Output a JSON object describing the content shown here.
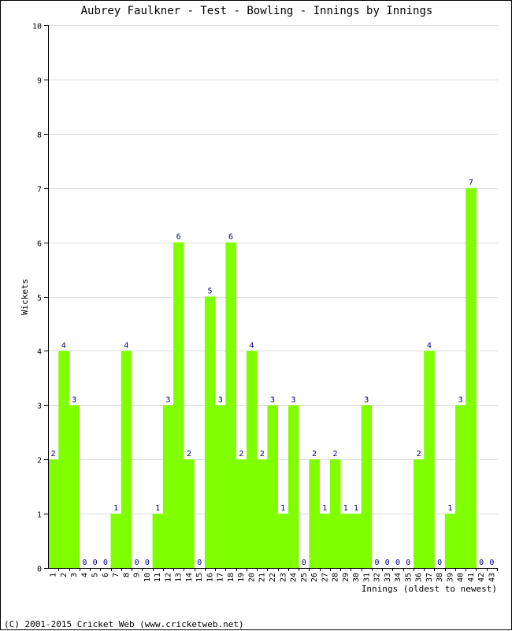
{
  "chart_data": {
    "type": "bar",
    "title": "Aubrey Faulkner - Test - Bowling - Innings by Innings",
    "xlabel": "Innings (oldest to newest)",
    "ylabel": "Wickets",
    "ylim": [
      0,
      10
    ],
    "yticks": [
      0,
      1,
      2,
      3,
      4,
      5,
      6,
      7,
      8,
      9,
      10
    ],
    "grid": true,
    "legend": "none",
    "categories": [
      "1",
      "2",
      "3",
      "4",
      "5",
      "6",
      "7",
      "8",
      "9",
      "10",
      "11",
      "12",
      "13",
      "14",
      "15",
      "16",
      "17",
      "18",
      "19",
      "20",
      "21",
      "22",
      "23",
      "24",
      "25",
      "26",
      "27",
      "28",
      "29",
      "30",
      "31",
      "32",
      "33",
      "34",
      "35",
      "36",
      "37",
      "38",
      "39",
      "40",
      "41",
      "42",
      "43"
    ],
    "values": [
      2,
      4,
      3,
      0,
      0,
      0,
      1,
      4,
      0,
      0,
      1,
      3,
      6,
      2,
      0,
      5,
      3,
      6,
      2,
      4,
      2,
      3,
      1,
      3,
      0,
      2,
      1,
      2,
      1,
      1,
      3,
      0,
      0,
      0,
      0,
      2,
      4,
      0,
      1,
      3,
      7,
      0,
      0
    ],
    "colors": {
      "bar": "#80ff00",
      "label": "#000080",
      "grid": "#dddddd"
    }
  },
  "footer": "(C) 2001-2015 Cricket Web (www.cricketweb.net)"
}
